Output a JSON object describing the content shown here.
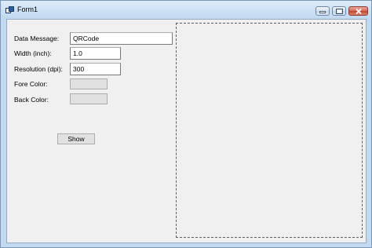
{
  "window": {
    "title": "Form1",
    "icons": {
      "app": "form-window-icon",
      "minimize": "minimize-icon",
      "maximize": "maximize-icon",
      "close": "close-icon"
    }
  },
  "form": {
    "data_message_label": "Data Message:",
    "data_message_value": "QRCode",
    "width_label": "Width (inch):",
    "width_value": "1.0",
    "resolution_label": "Resolution (dpi):",
    "resolution_value": "300",
    "fore_color_label": "Fore Color:",
    "back_color_label": "Back Color:",
    "show_button": "Show"
  },
  "colors": {
    "client_background": "#f0f0f0",
    "color_swatch": "#e1e1e1",
    "title_bar": "#c2d9f0"
  }
}
